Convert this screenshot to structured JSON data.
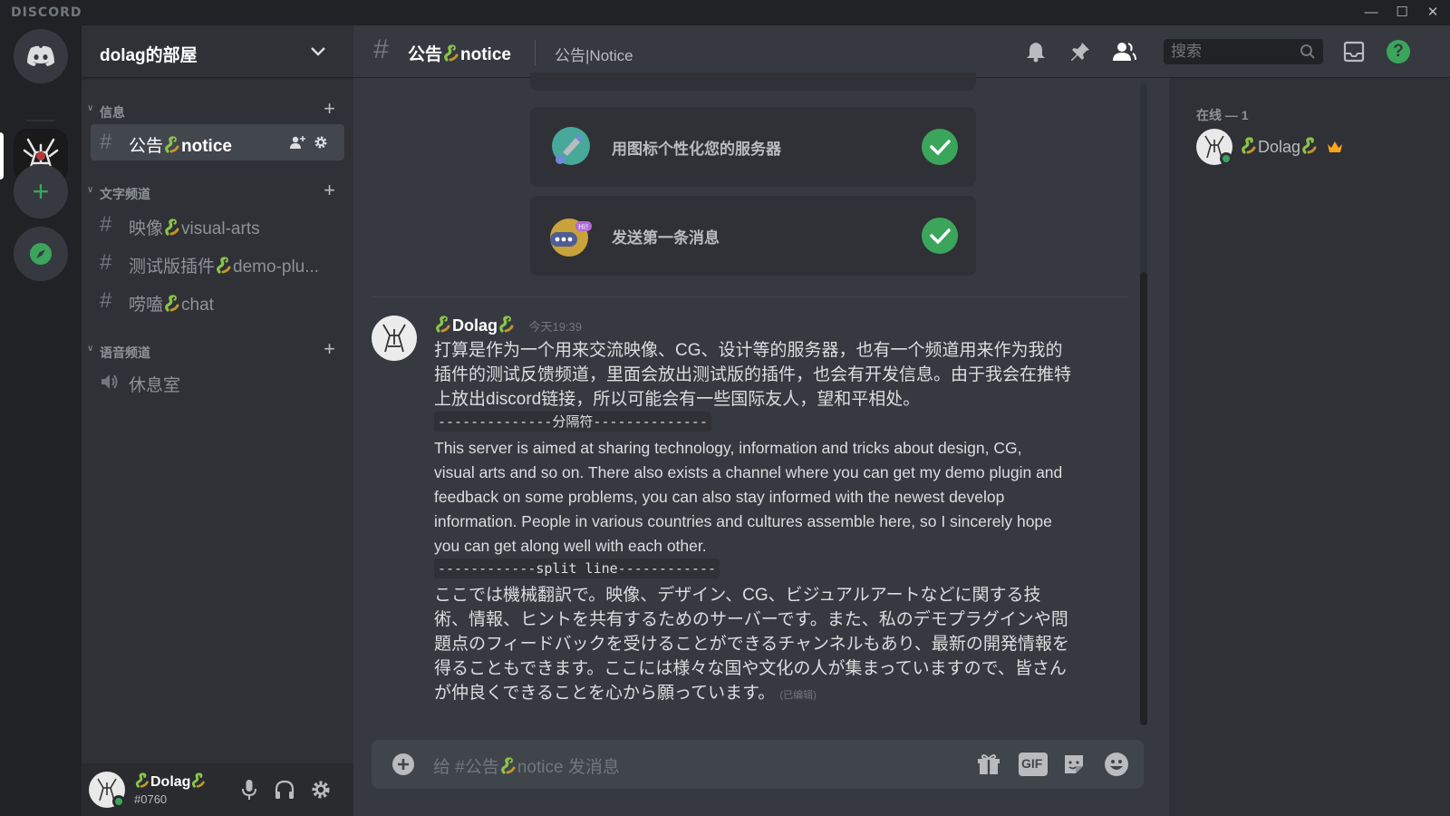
{
  "titlebar": {
    "brand": "DISCORD"
  },
  "server": {
    "name": "dolag的部屋"
  },
  "categories": {
    "info": {
      "label": "信息"
    },
    "text": {
      "label": "文字频道"
    },
    "voice": {
      "label": "语音频道"
    }
  },
  "channels": {
    "notice": {
      "prefix": "公告",
      "suffix": "notice"
    },
    "visual": {
      "prefix": "映像",
      "suffix": "visual-arts"
    },
    "demo": {
      "prefix": "测试版插件",
      "suffix": "demo-plu..."
    },
    "chat": {
      "prefix": "唠嗑",
      "suffix": "chat"
    },
    "rest": {
      "label": "休息室"
    }
  },
  "header": {
    "channel_prefix": "公告",
    "channel_suffix": "notice",
    "topic": "公告|Notice",
    "search_placeholder": "搜索"
  },
  "setup_cards": [
    {
      "label": "用图标个性化您的服务器"
    },
    {
      "label": "发送第一条消息"
    }
  ],
  "message": {
    "author": "Dolag",
    "timestamp": "今天19:39",
    "zh_lines": [
      "打算是作为一个用来交流映像、CG、设计等的服务器，也有一个频道用来作为我的",
      "插件的测试反馈频道，里面会放出测试版的插件，也会有开发信息。由于我会在推特",
      "上放出discord链接，所以可能会有一些国际友人，望和平相处。"
    ],
    "code1": "--------------分隔符--------------",
    "en_lines": [
      "This server is aimed at sharing technology, information and tricks about design, CG,",
      "visual arts and so on. There also exists a channel where you can get my demo plugin and",
      "feedback on some problems, you can also stay informed with the newest develop",
      "information. People in various countries and cultures assemble here, so I sincerely hope",
      "you can get along well with each other."
    ],
    "code2": "------------split line------------",
    "ja_lines": [
      "ここでは機械翻訳で。映像、デザイン、CG、ビジュアルアートなどに関する技",
      "術、情報、ヒントを共有するためのサーバーです。また、私のデモプラグインや問",
      "題点のフィードバックを受けることができるチャンネルもあり、最新の開発情報を",
      "得ることもできます。ここには様々な国や文化の人が集まっていますので、皆さん",
      "が仲良くできることを心から願っています。"
    ],
    "edited": "(已编辑)"
  },
  "composer": {
    "placeholder_prefix": "给 #公告",
    "placeholder_suffix": "notice 发消息",
    "gif": "GIF"
  },
  "user": {
    "name": "Dolag",
    "tag": "#0760"
  },
  "members": {
    "header": "在线 — 1",
    "list": [
      {
        "name": "Dolag"
      }
    ]
  },
  "colors": {
    "accent": "#3ba55c",
    "blurple": "#7289da",
    "crown": "#faa61a"
  }
}
